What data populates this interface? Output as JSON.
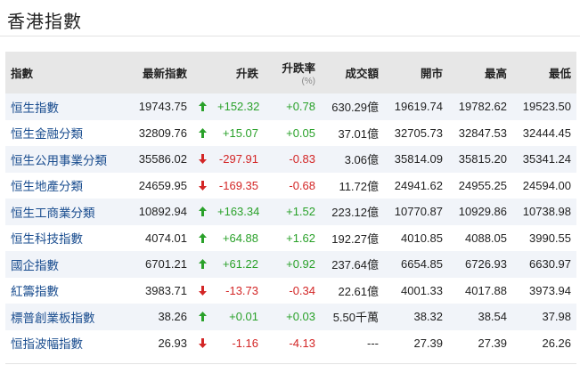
{
  "page": {
    "title": "香港指數"
  },
  "table": {
    "headers": {
      "name": "指數",
      "last": "最新指數",
      "change": "升跌",
      "pct": "升跌率",
      "pct_unit": "(%)",
      "turnover": "成交額",
      "open": "開市",
      "high": "最高",
      "low": "最低"
    },
    "rows": [
      {
        "name": "恒生指數",
        "last": "19743.75",
        "dir": "up",
        "change": "+152.32",
        "pct": "+0.78",
        "turnover": "630.29億",
        "open": "19619.74",
        "high": "19782.62",
        "low": "19523.50"
      },
      {
        "name": "恒生金融分類",
        "last": "32809.76",
        "dir": "up",
        "change": "+15.07",
        "pct": "+0.05",
        "turnover": "37.01億",
        "open": "32705.73",
        "high": "32847.53",
        "low": "32444.45"
      },
      {
        "name": "恒生公用事業分類",
        "last": "35586.02",
        "dir": "down",
        "change": "-297.91",
        "pct": "-0.83",
        "turnover": "3.06億",
        "open": "35814.09",
        "high": "35815.20",
        "low": "35341.24"
      },
      {
        "name": "恒生地產分類",
        "last": "24659.95",
        "dir": "down",
        "change": "-169.35",
        "pct": "-0.68",
        "turnover": "11.72億",
        "open": "24941.62",
        "high": "24955.25",
        "low": "24594.00"
      },
      {
        "name": "恒生工商業分類",
        "last": "10892.94",
        "dir": "up",
        "change": "+163.34",
        "pct": "+1.52",
        "turnover": "223.12億",
        "open": "10770.87",
        "high": "10929.86",
        "low": "10738.98"
      },
      {
        "name": "恒生科技指數",
        "last": "4074.01",
        "dir": "up",
        "change": "+64.88",
        "pct": "+1.62",
        "turnover": "192.27億",
        "open": "4010.85",
        "high": "4088.05",
        "low": "3990.55"
      },
      {
        "name": "國企指數",
        "last": "6701.21",
        "dir": "up",
        "change": "+61.22",
        "pct": "+0.92",
        "turnover": "237.64億",
        "open": "6654.85",
        "high": "6726.93",
        "low": "6630.97"
      },
      {
        "name": "紅籌指數",
        "last": "3983.71",
        "dir": "down",
        "change": "-13.73",
        "pct": "-0.34",
        "turnover": "22.61億",
        "open": "4001.33",
        "high": "4017.88",
        "low": "3973.94"
      },
      {
        "name": "標普創業板指數",
        "last": "38.26",
        "dir": "up",
        "change": "+0.01",
        "pct": "+0.03",
        "turnover": "5.50千萬",
        "open": "38.32",
        "high": "38.54",
        "low": "37.98"
      },
      {
        "name": "恒指波幅指數",
        "last": "26.93",
        "dir": "down",
        "change": "-1.16",
        "pct": "-4.13",
        "turnover": "---",
        "open": "27.39",
        "high": "27.39",
        "low": "26.26"
      }
    ]
  },
  "colors": {
    "up": "#2aa12a",
    "down": "#d32626",
    "link": "#1a4d8f",
    "header_bg": "#e7e7e7",
    "stripe": "#f1f4f9"
  },
  "icons": {
    "up": "arrow-up-icon",
    "down": "arrow-down-icon"
  }
}
